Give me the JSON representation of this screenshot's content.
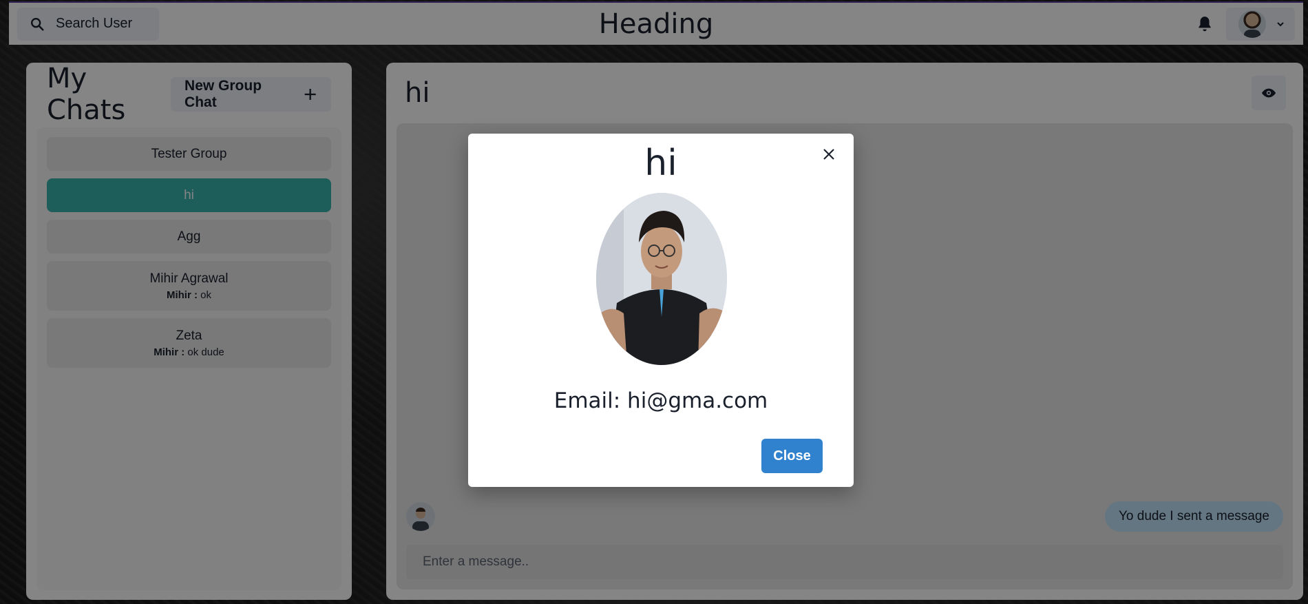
{
  "header": {
    "search_label": "Search User",
    "title": "Heading",
    "icons": {
      "search": "search-icon",
      "notifications": "bell-icon",
      "menu": "chevron-down-icon"
    }
  },
  "chats": {
    "title": "My Chats",
    "new_group_label": "New Group Chat",
    "items": [
      {
        "name": "Tester Group",
        "sender": "",
        "latest": ""
      },
      {
        "name": "hi",
        "sender": "",
        "latest": "",
        "active": true
      },
      {
        "name": "Agg",
        "sender": "",
        "latest": ""
      },
      {
        "name": "Mihir Agrawal",
        "sender": "Mihir :",
        "latest": "ok"
      },
      {
        "name": "Zeta",
        "sender": "Mihir :",
        "latest": "ok dude"
      }
    ]
  },
  "chatbox": {
    "title": "hi",
    "message": "Yo dude I sent a message",
    "input_placeholder": "Enter a message.."
  },
  "modal": {
    "title": "hi",
    "email": "Email: hi@gma.com",
    "close_label": "Close"
  },
  "colors": {
    "accent_teal": "#38b2ac",
    "button_blue": "#3182ce",
    "bubble_blue": "#bee3f8",
    "topbar_border": "#5a3d9a"
  }
}
